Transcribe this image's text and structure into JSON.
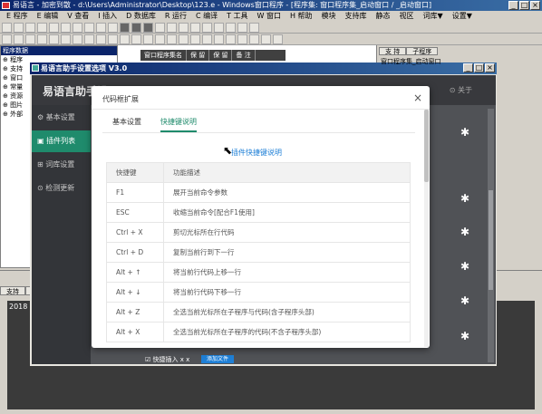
{
  "ide": {
    "title": "易语言 - 加密到散 - d:\\Users\\Administrator\\Desktop\\123.e - Windows窗口程序 - [程序集: 窗口程序集_启动窗口 / _启动窗口]",
    "menus": [
      "E 程序",
      "E 编辑",
      "V 查看",
      "I 插入",
      "D 数据库",
      "R 运行",
      "C 编译",
      "T 工具",
      "W 窗口",
      "H 帮助",
      "模块",
      "支持库",
      "静态",
      "视区",
      "词库▼",
      "设置▼"
    ],
    "sidebar": {
      "rows": [
        "程序数据",
        "⊕ 程序",
        "⊕ 支持",
        "⊕ 窗口",
        "⊕ 常量",
        "⊕ 资源",
        "⊕ 图片",
        "⊕ 外部"
      ]
    },
    "code_header": [
      "窗口程序集名",
      "保 留",
      "保 留",
      "备 注"
    ],
    "right_tabs": [
      "支 持",
      "子程序"
    ],
    "right_item": "窗口程序集_启动窗口",
    "bottom_tabs": [
      "支持",
      "提示",
      "输出"
    ],
    "bottom_text": "2018"
  },
  "helper": {
    "window_title": "易语言助手设置选项 V3.0",
    "header_title": "易语言助手设置",
    "about": "⊙ 关于",
    "nav": [
      {
        "label": "⚙ 基本设置",
        "active": false
      },
      {
        "label": "▣ 插件列表",
        "active": true
      },
      {
        "label": "⊞ 词库设置",
        "active": false
      },
      {
        "label": "⊙ 检测更新",
        "active": false
      }
    ],
    "footer_check": "☑ 快捷插入 x x",
    "footer_btn": "添加文件"
  },
  "modal": {
    "title": "代码框扩展",
    "close": "×",
    "tabs": [
      {
        "label": "基本设置",
        "active": false
      },
      {
        "label": "快捷键说明",
        "active": true
      }
    ],
    "link": "插件快捷键说明",
    "table": {
      "headers": [
        "快捷键",
        "功能描述"
      ],
      "rows": [
        [
          "F1",
          "展开当前命令参数"
        ],
        [
          "ESC",
          "收缩当前命令[配合F1使用]"
        ],
        [
          "Ctrl + X",
          "剪切光标所在行代码"
        ],
        [
          "Ctrl + D",
          "复制当前行到下一行"
        ],
        [
          "Alt + ↑",
          "将当前行代码上移一行"
        ],
        [
          "Alt + ↓",
          "将当前行代码下移一行"
        ],
        [
          "Alt + Z",
          "全选当前光标所在子程序与代码(含子程序头部)"
        ],
        [
          "Alt + X",
          "全选当前光标所在子程序的代码(不含子程序头部)"
        ]
      ]
    }
  },
  "colors": {
    "accent": "#1f8b6c",
    "link": "#1e7fd6",
    "header_dark": "#38393d"
  }
}
